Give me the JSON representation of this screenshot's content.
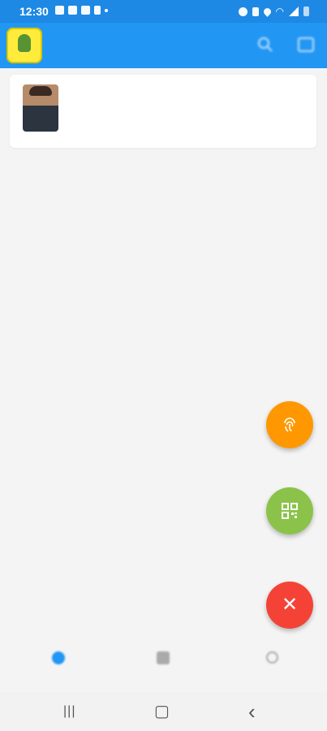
{
  "status_bar": {
    "time": "12:30",
    "left_icons": [
      "image-icon",
      "photo-icon",
      "gmail-icon",
      "clipboard-icon",
      "dot-icon"
    ],
    "right_icons": [
      "alarm-icon",
      "vibrate-icon",
      "location-icon",
      "wifi-icon",
      "signal-icon",
      "battery-icon"
    ]
  },
  "app_bar": {
    "logo_icon": "app-logo-icon",
    "title": "",
    "subtitle": "",
    "actions": [
      "search-icon",
      "scan-icon"
    ]
  },
  "cards": [
    {
      "avatar": "person-photo",
      "name": "",
      "detail": ""
    }
  ],
  "fabs": [
    {
      "icon": "fingerprint-icon",
      "color": "#ff9800"
    },
    {
      "icon": "qr-code-icon",
      "color": "#8bc34a"
    },
    {
      "icon": "close-icon",
      "glyph": "✕",
      "color": "#f44336"
    }
  ],
  "bottom_nav": {
    "items": [
      {
        "icon": "home-icon",
        "label": "",
        "active": true
      },
      {
        "icon": "bag-icon",
        "label": "",
        "active": false
      },
      {
        "icon": "search-icon",
        "label": "",
        "active": false
      }
    ],
    "active_color": "#2196f3"
  },
  "system_nav": {
    "recent": "|||",
    "home": "▢",
    "back": "‹"
  },
  "colors": {
    "status_bar": "#1e88e5",
    "app_bar": "#2196f3",
    "background": "#f4f4f4"
  }
}
